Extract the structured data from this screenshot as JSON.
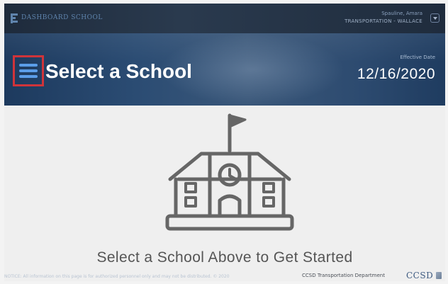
{
  "topbar": {
    "app_name": "DASHBOARD SCHOOL",
    "user_name": "Spauline, Amara",
    "user_role": "TRANSPORTATION - WALLACE"
  },
  "header": {
    "title": "Select a School",
    "date_label": "Effective Date",
    "date_value": "12/16/2020"
  },
  "main": {
    "prompt": "Select a School Above to Get Started"
  },
  "footer": {
    "disclaimer": "NOTICE: All information on this page is for authorized personnel only and may not be distributed. © 2020",
    "department": "CCSD Transportation Department",
    "logo_text": "CCSD"
  },
  "colors": {
    "topbar_bg": "#1e2b3c",
    "header_bg": "#2b4c73",
    "menu_highlight": "#d0343a",
    "menu_icon": "#5b9de8",
    "content_bg": "#efefef",
    "icon_stroke": "#666666",
    "text_muted": "#555555"
  },
  "icons": {
    "menu": "hamburger-icon",
    "school": "school-building-icon",
    "user_dropdown": "chevron-down-icon"
  }
}
